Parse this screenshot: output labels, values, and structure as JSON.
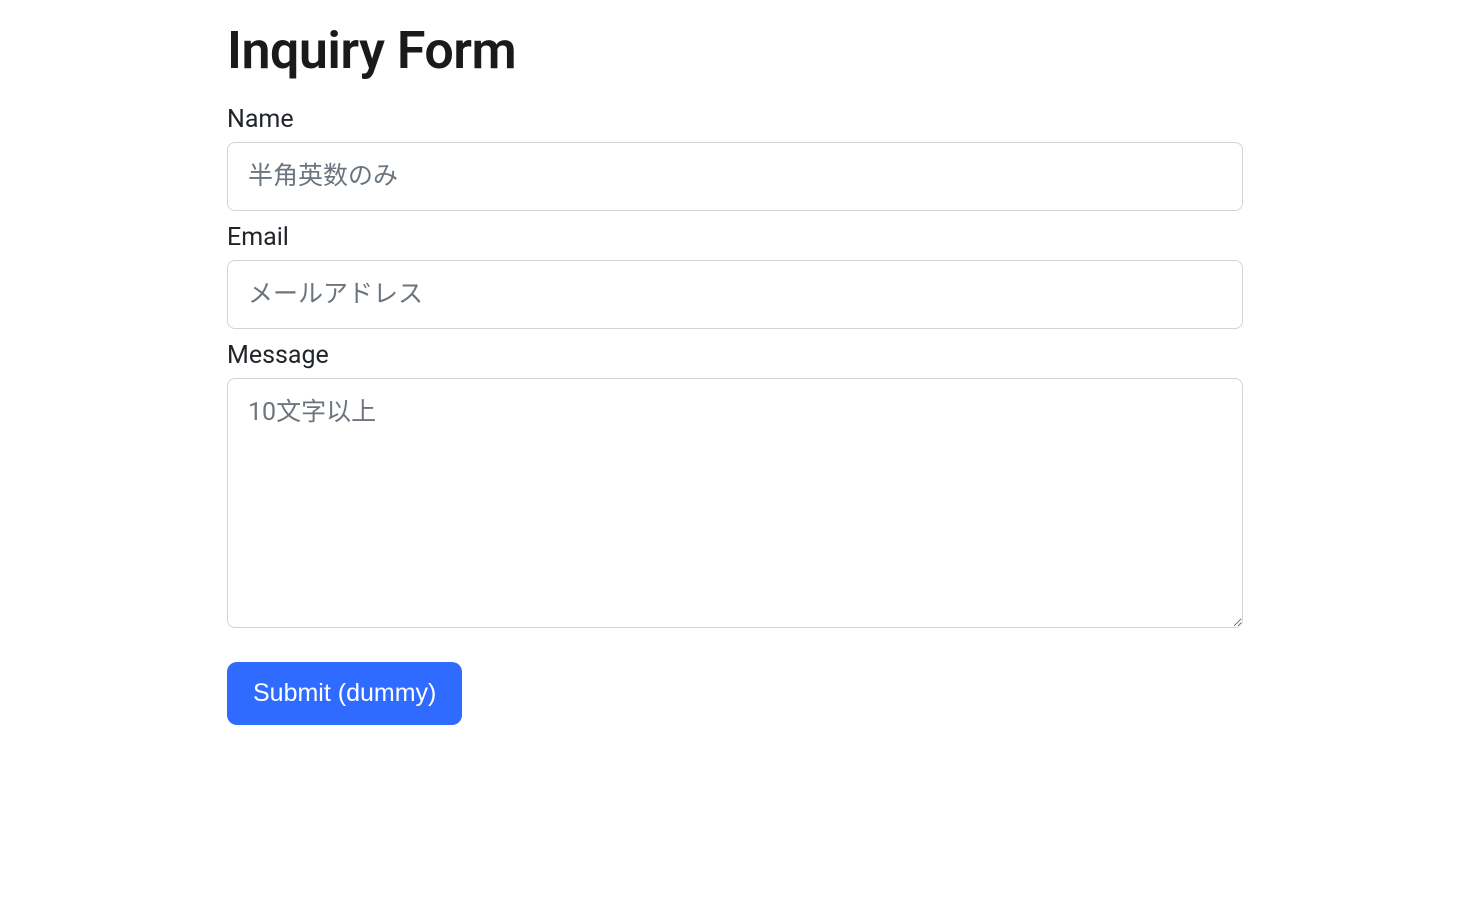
{
  "page": {
    "title": "Inquiry Form"
  },
  "form": {
    "name": {
      "label": "Name",
      "placeholder": "半角英数のみ",
      "value": ""
    },
    "email": {
      "label": "Email",
      "placeholder": "メールアドレス",
      "value": ""
    },
    "message": {
      "label": "Message",
      "placeholder": "10文字以上",
      "value": ""
    },
    "submit": {
      "label": "Submit (dummy)"
    }
  },
  "colors": {
    "primary": "#2F6BFF",
    "text": "#212529",
    "placeholder": "#6c757d",
    "border": "#ced4da"
  }
}
